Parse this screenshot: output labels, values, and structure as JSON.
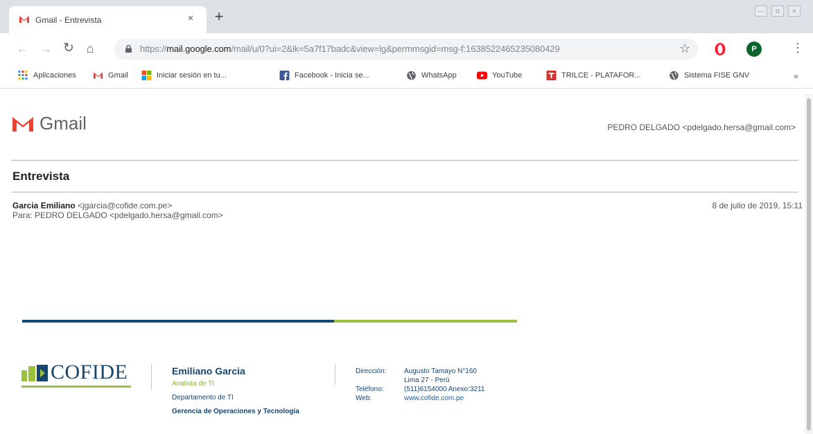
{
  "browser": {
    "tab_title": "Gmail - Entrevista",
    "tab_close": "×",
    "new_tab": "+",
    "url_prefix": "https://",
    "url_host": "mail.google.com",
    "url_path": "/mail/u/0?ui=2&ik=5a7f17badc&view=lg&permmsgid=msg-f:1638522465235080429",
    "profile_initial": "P",
    "window_controls": {
      "minimize": "—",
      "restore": "⧉",
      "close": "✕"
    }
  },
  "bookmarks": [
    {
      "label": "Aplicaciones",
      "icon": "apps-grid-icon"
    },
    {
      "label": "Gmail",
      "icon": "gmail-icon"
    },
    {
      "label": "Iniciar sesión en tu...",
      "icon": "microsoft-icon"
    },
    {
      "label": "Facebook - Inicia se...",
      "icon": "facebook-icon"
    },
    {
      "label": "WhatsApp",
      "icon": "globe-icon"
    },
    {
      "label": "YouTube",
      "icon": "youtube-icon"
    },
    {
      "label": "TRILCE - PLATAFOR...",
      "icon": "trilce-icon"
    },
    {
      "label": "Sistema FISE GNV",
      "icon": "globe-icon"
    }
  ],
  "bookmarks_more": "»",
  "gmail": {
    "logo_text": "Gmail",
    "account": "PEDRO DELGADO <pdelgado.hersa@gmail.com>"
  },
  "email": {
    "subject": "Entrevista",
    "from_name": "Garcia Emiliano",
    "from_addr": "<jgarcia@cofide.com.pe>",
    "to": "Para: PEDRO DELGADO <pdelgado.hersa@gmail.com>",
    "date": "8 de julio de 2019, 15:11"
  },
  "signature": {
    "company_logo": "COFIDE",
    "name": "Emiliano Garcia",
    "role": "Analista de TI",
    "department": "Departamento de TI",
    "management": "Gerencia de Operaciones y Tecnología",
    "labels": [
      "Dirección:",
      "",
      "Teléfono:",
      "Web:"
    ],
    "values": [
      "Augusto Tamayo N°160",
      "Lima 27 - Perú",
      "(511)6154000 Anexo:3211",
      "www.cofide.com.pe"
    ]
  },
  "colors": {
    "cofide_blue": "#17456d",
    "cofide_green": "#9ac13c",
    "gmail_red": "#ea4335"
  }
}
